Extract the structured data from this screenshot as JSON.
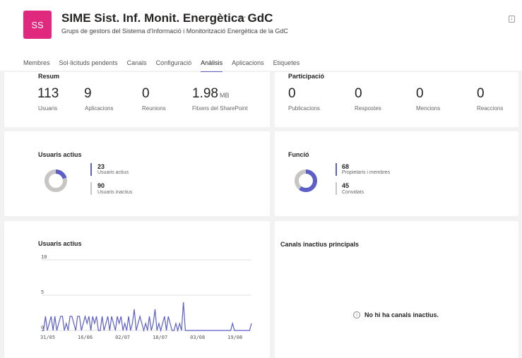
{
  "header": {
    "avatar_initials": "SS",
    "title": "SIME Sist. Inf. Monit. Energètica GdC",
    "more": "···",
    "subtitle": "Grups de gestors del Sistema d'Informació i Monitorització Energètica de la GdC"
  },
  "tabs": [
    {
      "label": "Membres"
    },
    {
      "label": "Sol·licituds pendents"
    },
    {
      "label": "Canals"
    },
    {
      "label": "Configuració"
    },
    {
      "label": "Anàlisis",
      "active": true
    },
    {
      "label": "Aplicacions"
    },
    {
      "label": "Etiquetes"
    }
  ],
  "resum": {
    "title": "Resum",
    "stats": [
      {
        "value": "113",
        "label": "Usuaris"
      },
      {
        "value": "9",
        "label": "Aplicacions"
      },
      {
        "value": "0",
        "label": "Reunions"
      },
      {
        "value": "1.98",
        "unit": "MB",
        "label": "Fitxers del SharePoint"
      }
    ]
  },
  "participacio": {
    "title": "Participació",
    "stats": [
      {
        "value": "0",
        "label": "Publicacions"
      },
      {
        "value": "0",
        "label": "Respostes"
      },
      {
        "value": "0",
        "label": "Mencions"
      },
      {
        "value": "0",
        "label": "Reaccions"
      }
    ]
  },
  "usuaris_actius_donut": {
    "title": "Usuaris actius",
    "items": [
      {
        "value": "23",
        "label": "Usuaris actius",
        "color": "#5b5fc7"
      },
      {
        "value": "90",
        "label": "Usuaris inactius",
        "color": "#c8c6c4"
      }
    ]
  },
  "funcio_donut": {
    "title": "Funció",
    "items": [
      {
        "value": "68",
        "label": "Propietaris i membres",
        "color": "#5b5fc7"
      },
      {
        "value": "45",
        "label": "Convidats",
        "color": "#c8c6c4"
      }
    ]
  },
  "usuaris_actius_chart": {
    "title": "Usuaris actius"
  },
  "canals_inactius": {
    "title": "Canals inactius principals",
    "empty_message": "No hi ha canals inactius.",
    "icon": "info-icon"
  },
  "chart_data": {
    "type": "line",
    "title": "Usuaris actius",
    "ylim": [
      0,
      10
    ],
    "yticks": [
      "0",
      "5",
      "10"
    ],
    "xticks": [
      "31/05",
      "16/06",
      "02/07",
      "18/07",
      "03/08",
      "19/08"
    ],
    "grid": true,
    "series": [
      {
        "color": "#5b5fc7",
        "values": [
          0,
          0,
          2,
          0,
          1,
          2,
          0,
          2,
          0,
          1,
          2,
          2,
          0,
          1,
          0,
          2,
          2,
          1,
          0,
          2,
          2,
          0,
          1,
          2,
          1,
          2,
          0,
          2,
          1,
          2,
          0,
          0,
          2,
          0,
          1,
          2,
          0,
          2,
          1,
          0,
          2,
          1,
          2,
          0,
          1,
          0,
          2,
          0,
          1,
          3,
          0,
          1,
          2,
          1,
          0,
          1,
          0,
          2,
          0,
          1,
          3,
          0,
          1,
          0,
          1,
          2,
          0,
          2,
          1,
          0,
          0,
          1,
          0,
          1,
          0,
          4,
          0,
          0,
          0,
          0,
          0,
          0,
          0,
          0,
          0,
          0,
          0,
          0,
          0,
          0,
          0,
          0,
          0,
          0,
          0,
          0,
          0,
          0,
          0,
          0,
          0,
          1,
          0,
          0,
          0,
          0,
          0,
          0,
          0,
          0,
          0,
          1
        ]
      }
    ]
  }
}
